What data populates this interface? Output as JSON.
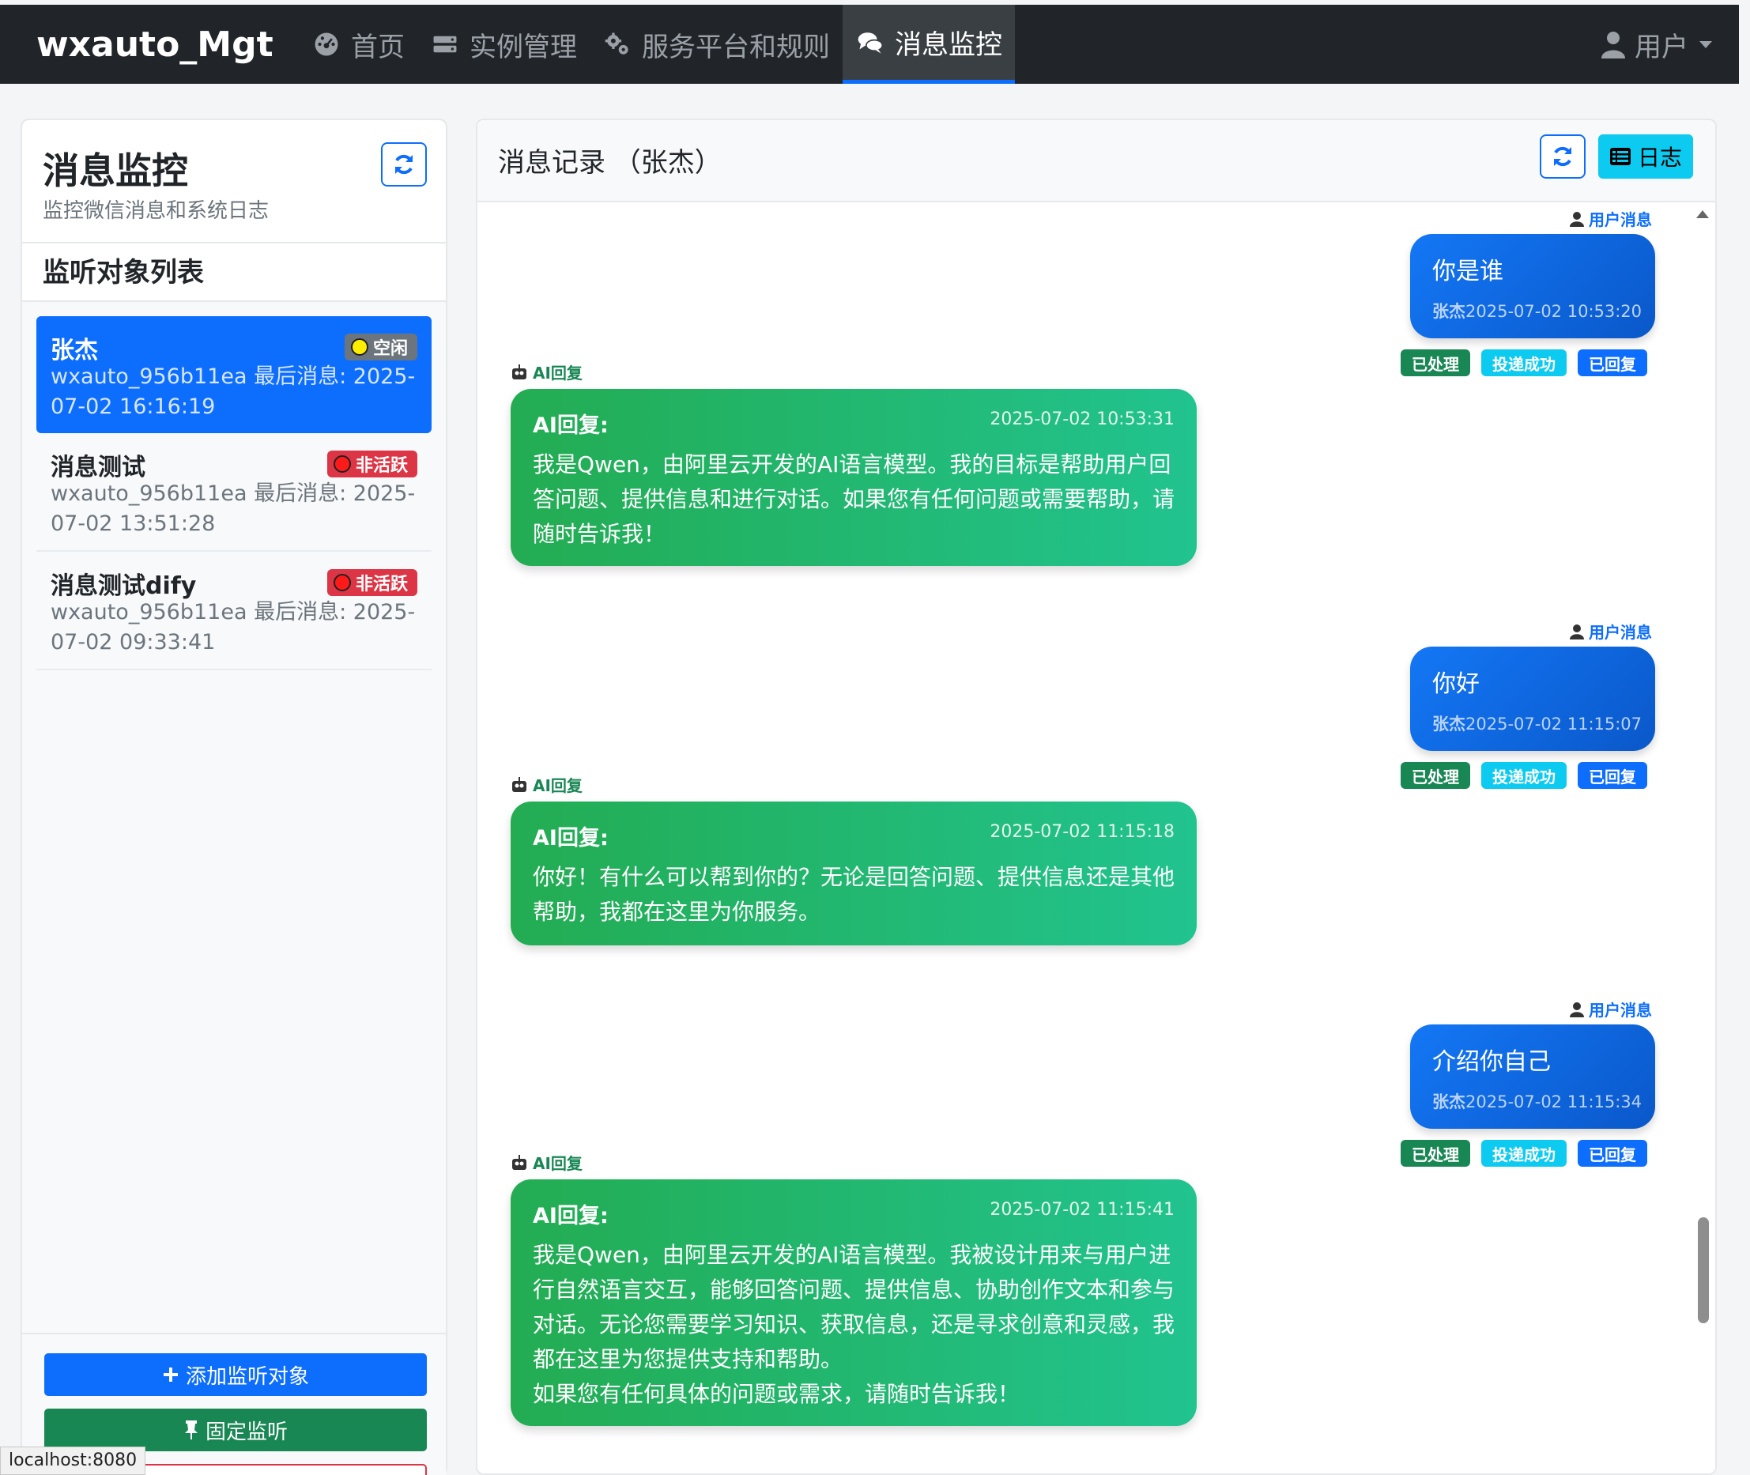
{
  "navbar": {
    "brand": "wxauto_Mgt",
    "items": [
      {
        "label": "首页",
        "icon": "dashboard-icon"
      },
      {
        "label": "实例管理",
        "icon": "server-icon"
      },
      {
        "label": "服务平台和规则",
        "icon": "gears-icon"
      },
      {
        "label": "消息监控",
        "icon": "comments-icon",
        "active": true
      }
    ],
    "user_label": "用户"
  },
  "sidebar": {
    "title": "消息监控",
    "subtitle": "监控微信消息和系统日志",
    "list_title": "监听对象列表",
    "targets": [
      {
        "name": "张杰",
        "meta": "wxauto_956b11ea   最后消息: 2025-07-02 16:16:19",
        "status": "空闲",
        "status_color": "#ffee00",
        "active": true
      },
      {
        "name": "消息测试",
        "meta": "wxauto_956b11ea   最后消息: 2025-07-02 13:51:28",
        "status": "非活跃",
        "status_color": "#dc3545"
      },
      {
        "name": "消息测试dify",
        "meta": "wxauto_956b11ea   最后消息: 2025-07-02 09:33:41",
        "status": "非活跃",
        "status_color": "#dc3545"
      }
    ],
    "add_button": "添加监听对象",
    "pin_button": "固定监听"
  },
  "messages_panel": {
    "title": "消息记录  （张杰）",
    "log_button": "日志",
    "user_tag": "用户消息",
    "ai_tag": "AI回复",
    "ai_head": "AI回复:",
    "status_labels": [
      "已处理",
      "投递成功",
      "已回复"
    ],
    "conversation": [
      {
        "user_text": "你是谁",
        "user_sender": "张杰",
        "user_time": "2025-07-02 10:53:20",
        "ai_time": "2025-07-02 10:53:31",
        "ai_text": "我是Qwen，由阿里云开发的AI语言模型。我的目标是帮助用户回答问题、提供信息和进行对话。如果您有任何问题或需要帮助，请随时告诉我！"
      },
      {
        "user_text": "你好",
        "user_sender": "张杰",
        "user_time": "2025-07-02 11:15:07",
        "ai_time": "2025-07-02 11:15:18",
        "ai_text": "你好！有什么可以帮到你的？无论是回答问题、提供信息还是其他帮助，我都在这里为你服务。"
      },
      {
        "user_text": "介绍你自己",
        "user_sender": "张杰",
        "user_time": "2025-07-02 11:15:34",
        "ai_time": "2025-07-02 11:15:41",
        "ai_text": "我是Qwen，由阿里云开发的AI语言模型。我被设计用来与用户进行自然语言交互，能够回答问题、提供信息、协助创作文本和参与对话。无论您需要学习知识、获取信息，还是寻求创意和灵感，我都在这里为您提供支持和帮助。\n如果您有任何具体的问题或需求，请随时告诉我！"
      }
    ]
  },
  "browser_status": "localhost:8080",
  "colors": {
    "primary": "#0d6efd",
    "success": "#198754",
    "info": "#0dcaf0",
    "danger": "#dc3545",
    "navbar": "#212529"
  }
}
